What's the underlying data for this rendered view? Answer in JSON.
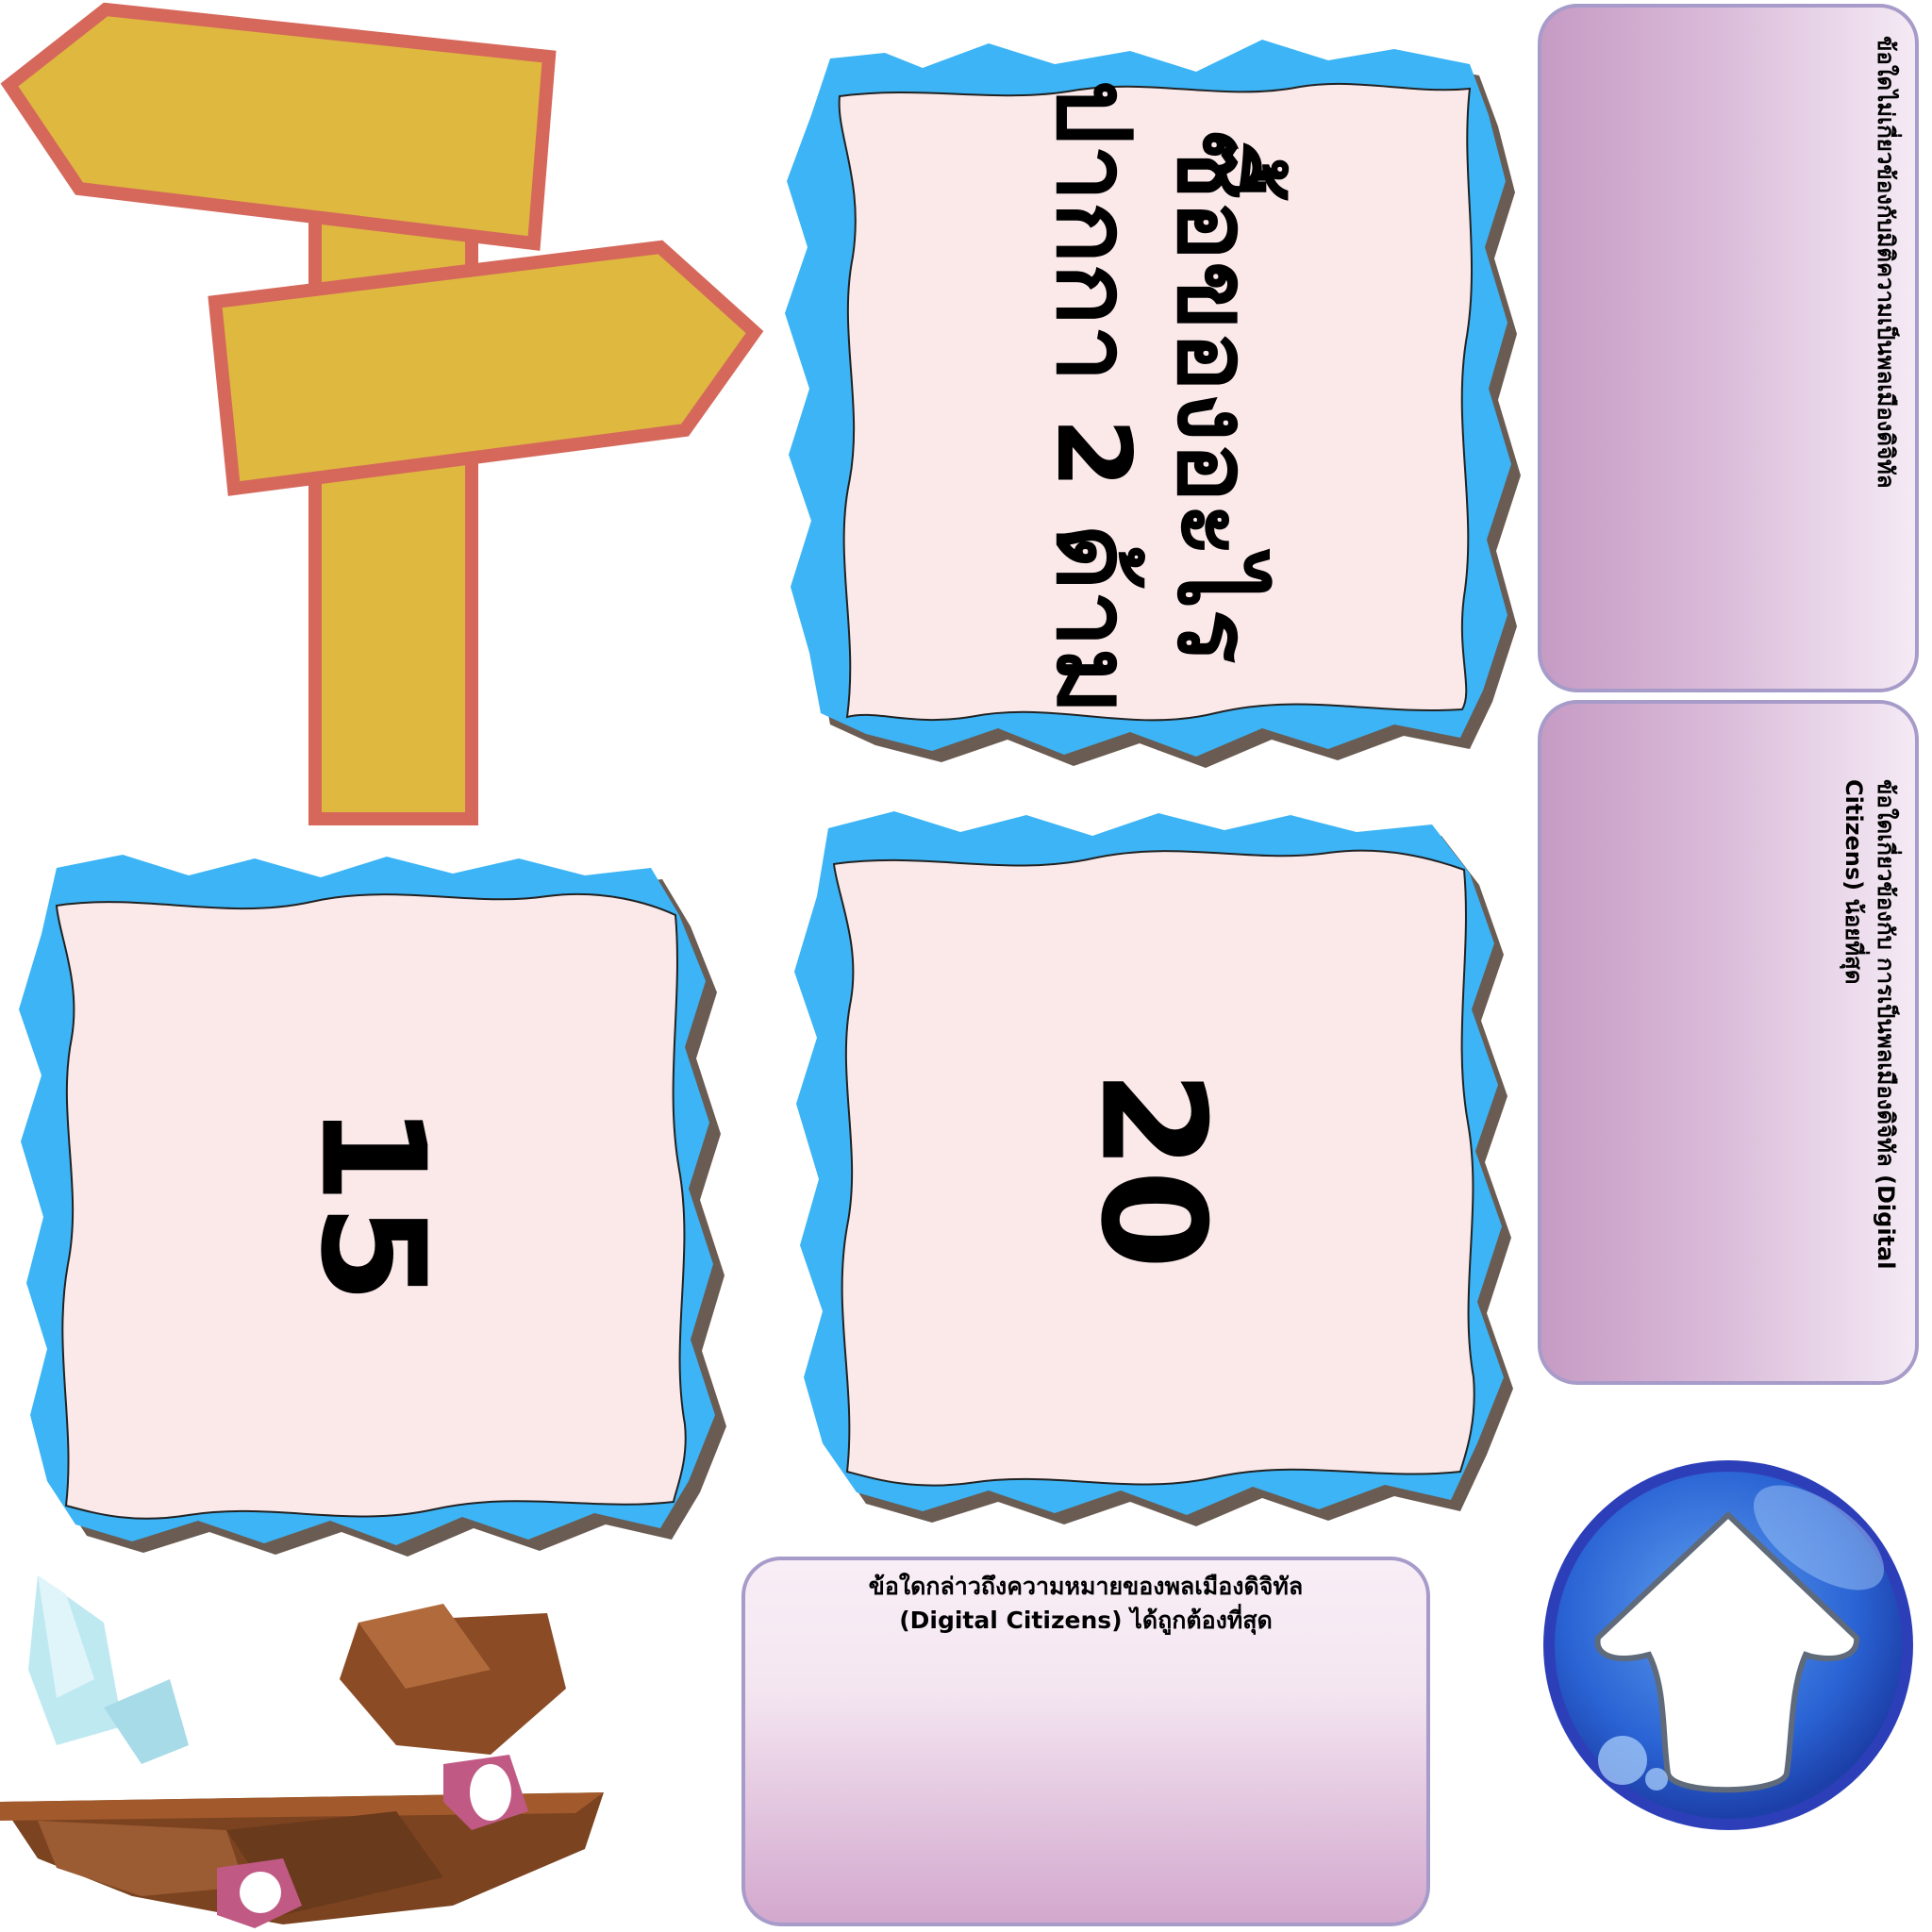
{
  "cards": {
    "top": {
      "line1": "ซื้อของอะไร",
      "line2": "ปากกา 2 ด้าม"
    },
    "left": {
      "value": "15"
    },
    "center": {
      "value": "20"
    }
  },
  "panels": {
    "top_right": {
      "text": "ข้อใดไม่เกี่ยวข้องกับมิติความเป็นพลเมืองดิจิทัล"
    },
    "mid_right": {
      "text": "ข้อใดเกี่ยวข้องกับ การเป็นพลเมืองดิจิทัล (Digital Citizens) น้อยที่สุด"
    },
    "bottom": {
      "line1": "ข้อใดกล่าวถึงความหมายของพลเมืองดิจิทัล",
      "line2": "(Digital Citizens) ได้ถูกต้องที่สุด"
    }
  },
  "icons": {
    "signpost": "signpost-icon",
    "up_arrow": "up-arrow-icon",
    "island": "floating-rock-island"
  },
  "colors": {
    "sign_fill": "#dfb840",
    "sign_border": "#d5685b",
    "card_fill": "#fbe9ea",
    "card_edge": "#3cb4f5",
    "panel_border": "#a79bc9",
    "button_blue": "#2a63d4"
  }
}
